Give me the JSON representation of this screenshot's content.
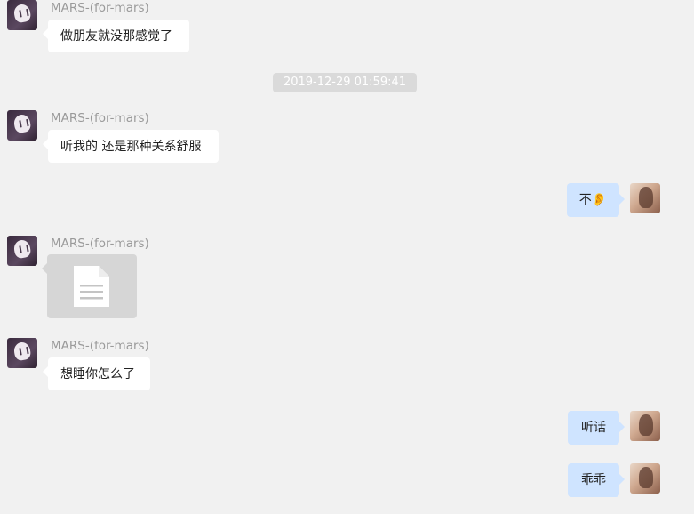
{
  "conversation": {
    "timestamp": "2019-12-29 01:59:41",
    "messages": [
      {
        "side": "left",
        "sender": "MARS-(for-mars)",
        "text": "做朋友就没那感觉了"
      },
      {
        "side": "left",
        "sender": "MARS-(for-mars)",
        "text": "听我的 还是那种关系舒服"
      },
      {
        "side": "right",
        "text": "不👂"
      },
      {
        "side": "left",
        "sender": "MARS-(for-mars)",
        "attachment": "file-icon"
      },
      {
        "side": "left",
        "sender": "MARS-(for-mars)",
        "text": "想睡你怎么了"
      },
      {
        "side": "right",
        "text": "听话"
      },
      {
        "side": "right",
        "text": "乖乖"
      }
    ]
  },
  "colors": {
    "background": "#f1f1f1",
    "left_bubble": "#ffffff",
    "right_bubble": "#cfe4ff",
    "sender_text": "#9a9a9a",
    "timestamp_bg": "#dadada"
  }
}
